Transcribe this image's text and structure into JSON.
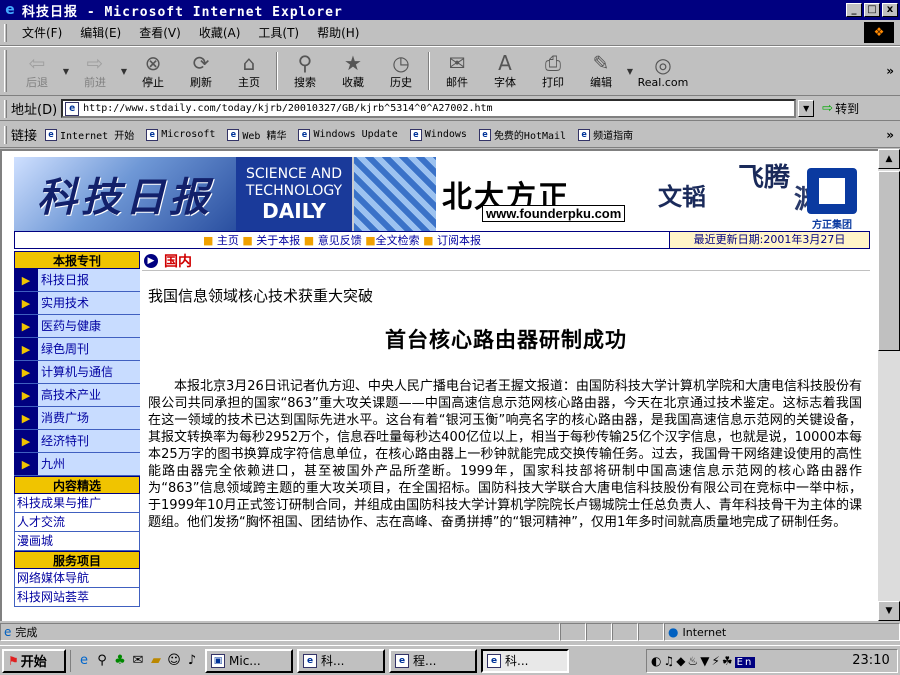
{
  "window": {
    "title": "科技日报 - Microsoft Internet Explorer",
    "min": "_",
    "max": "□",
    "close": "x"
  },
  "menu": [
    "文件(F)",
    "编辑(E)",
    "查看(V)",
    "收藏(A)",
    "工具(T)",
    "帮助(H)"
  ],
  "toolbar": {
    "back": "后退",
    "forward": "前进",
    "stop": "停止",
    "refresh": "刷新",
    "home": "主页",
    "search": "搜索",
    "favorites": "收藏",
    "history": "历史",
    "mail": "邮件",
    "font": "字体",
    "print": "打印",
    "edit": "编辑",
    "real": "Real.com"
  },
  "address": {
    "label": "地址(D)",
    "url": "http://www.stdaily.com/today/kjrb/20010327/GB/kjrb^5314^0^A27002.htm",
    "go": "转到"
  },
  "links": {
    "label": "链接",
    "items": [
      "Internet 开始",
      "Microsoft",
      "Web 精华",
      "Windows Update",
      "Windows",
      "免费的HotMail",
      "频道指南"
    ]
  },
  "banner": {
    "logo": "科技日报",
    "sci1": "SCIENCE AND",
    "sci2": "TECHNOLOGY",
    "daily": "DAILY",
    "ad_brand": "北大方正",
    "ad_url": "www.founderpku.com",
    "ad_wd": "文韬",
    "ad_fly": "飞腾",
    "ad_yb": "渊博",
    "ad_founder": "方正集团"
  },
  "nav": {
    "links": [
      "主页",
      "关于本报",
      "意见反馈",
      "全文检索",
      "订阅本报"
    ],
    "updated": "最近更新日期:2001年3月27日"
  },
  "sidebar": {
    "head1": "本报专刊",
    "items": [
      "科技日报",
      "实用技术",
      "医药与健康",
      "绿色周刊",
      "计算机与通信",
      "高技术产业",
      "消费广场",
      "经济特刊",
      "九州"
    ],
    "head2": "内容精选",
    "picks": [
      "科技成果与推广",
      "人才交流",
      "漫画城"
    ],
    "head3": "服务项目",
    "services": [
      "网络媒体导航",
      "科技网站荟萃"
    ]
  },
  "article": {
    "section": "国内",
    "subtitle": "我国信息领域核心技术获重大突破",
    "headline": "首台核心路由器研制成功",
    "body": "本报北京3月26日讯记者仇方迎、中央人民广播电台记者王握文报道：由国防科技大学计算机学院和大唐电信科技股份有限公司共同承担的国家“863”重大攻关课题——中国高速信息示范网核心路由器，今天在北京通过技术鉴定。这标志着我国在这一领域的技术已达到国际先进水平。这台有着“银河玉衡”响亮名字的核心路由器，是我国高速信息示范网的关键设备，其报文转换率为每秒2952万个，信息吞吐量每秒达400亿位以上，相当于每秒传输25亿个汉字信息，也就是说，10000本每本25万字的图书换算成字符信息单位，在核心路由器上一秒钟就能完成交换传输任务。过去，我国骨干网络建设使用的高性能路由器完全依赖进口，甚至被国外产品所垄断。1999年，国家科技部将研制中国高速信息示范网的核心路由器作为“863”信息领域跨主题的重大攻关项目，在全国招标。国防科技大学联合大唐电信科技股份有限公司在竞标中一举中标，于1999年10月正式签订研制合同，并组成由国防科技大学计算机学院院长卢锡城院士任总负责人、青年科技骨干为主体的课题组。他们发扬“胸怀祖国、团结协作、志在高峰、奋勇拼搏”的“银河精神”，仅用1年多时间就高质量地完成了研制任务。"
  },
  "status": {
    "text": "完成",
    "zone": "Internet"
  },
  "taskbar": {
    "start": "开始",
    "tasks": [
      "Mic...",
      "科...",
      "程...",
      "科..."
    ],
    "clock": "23:10",
    "ime": "En"
  }
}
